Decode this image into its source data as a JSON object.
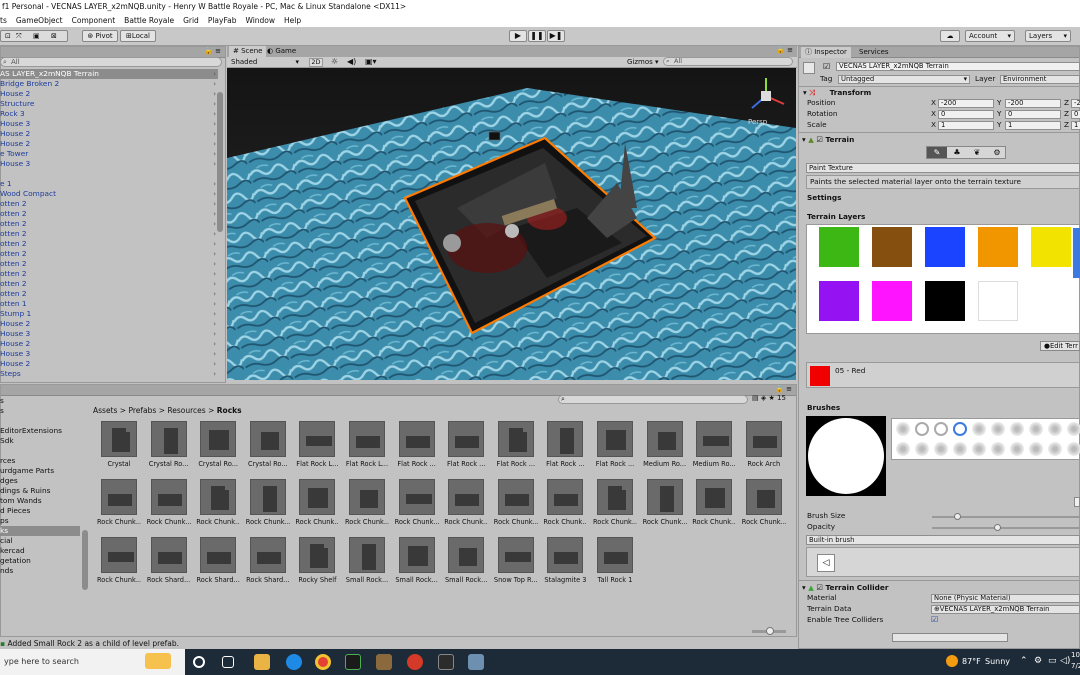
{
  "window": {
    "title": "f1 Personal - VECNAS LAYER_x2mNQB.unity - Henry W Battle Royale - PC, Mac & Linux Standalone <DX11>"
  },
  "menu": [
    "ts",
    "GameObject",
    "Component",
    "Battle Royale",
    "Grid",
    "PlayFab",
    "Window",
    "Help"
  ],
  "toolbar": {
    "pivot": "Pivot",
    "local": "Local",
    "account": "Account",
    "layers": "Layers"
  },
  "hierarchy": {
    "search_placeholder": "All",
    "items": [
      "AS LAYER_x2mNQB Terrain",
      "Bridge Broken 2",
      "House 2",
      "Structure",
      "Rock 3",
      "House 3",
      "House 2",
      "House 2",
      "e Tower",
      "House 3",
      "",
      "e 1",
      "Wood Compact",
      "otten 2",
      "otten 2",
      "otten 2",
      "otten 2",
      "otten 2",
      "otten 2",
      "otten 2",
      "otten 2",
      "otten 2",
      "otten 2",
      "otten 1",
      "Stump 1",
      "House 2",
      "House 3",
      "House 2",
      "House 3",
      "House 2",
      "Steps"
    ]
  },
  "scene": {
    "tab": "Scene",
    "game_tab": "Game",
    "shading": "Shaded",
    "mode2d": "2D",
    "gizmos": "Gizmos",
    "search_placeholder": "All",
    "persp": "Persp"
  },
  "project": {
    "folders": [
      "s",
      "s",
      "",
      "EditorExtensions",
      "Sdk",
      "",
      "rces",
      "urdgame Parts",
      "dges",
      "dings & Ruins",
      "tom Wands",
      "d Pieces",
      "ps",
      "ks",
      "cial",
      "kercad",
      "getation",
      "nds"
    ],
    "selected_folder_index": 13,
    "breadcrumb": [
      "Assets",
      "Prefabs",
      "Resources",
      "Rocks"
    ],
    "assets": [
      "Crystal",
      "Crystal Ro...",
      "Crystal Ro...",
      "Crystal Ro...",
      "Flat Rock L...",
      "Flat Rock L...",
      "Flat Rock ...",
      "Flat Rock ...",
      "Flat Rock ...",
      "Flat Rock ...",
      "Flat Rock ...",
      "Medium Ro...",
      "Medium Ro...",
      "Rock Arch",
      "Rock Chunk...",
      "Rock Chunk...",
      "Rock Chunk...",
      "Rock Chunk...",
      "Rock Chunk...",
      "Rock Chunk...",
      "Rock Chunk...",
      "Rock Chunk...",
      "Rock Chunk...",
      "Rock Chunk...",
      "Rock Chunk...",
      "Rock Chunk...",
      "Rock Chunk...",
      "Rock Chunk...",
      "Rock Chunk...",
      "Rock Shard...",
      "Rock Shard...",
      "Rock Shard...",
      "Rocky Shelf",
      "Small Rock...",
      "Small Rock...",
      "Small Rock...",
      "Snow Top R...",
      "Stalagmite 3",
      "Tall Rock 1"
    ],
    "badge": "15"
  },
  "status": {
    "message": "Added Small Rock 2 as a child of level prefab."
  },
  "inspector": {
    "tab": "Inspector",
    "services_tab": "Services",
    "object_name": "VECNAS LAYER_x2mNQB Terrain",
    "tag_label": "Tag",
    "tag_value": "Untagged",
    "layer_label": "Layer",
    "layer_value": "Environment",
    "transform": {
      "title": "Transform",
      "position_label": "Position",
      "rotation_label": "Rotation",
      "scale_label": "Scale",
      "x_label": "X",
      "y_label": "Y",
      "z_label": "Z",
      "position": {
        "x": "-200",
        "y": "-200",
        "z": "-2"
      },
      "rotation": {
        "x": "0",
        "y": "0",
        "z": "0"
      },
      "scale": {
        "x": "1",
        "y": "1",
        "z": "1"
      }
    },
    "terrain": {
      "title": "Terrain",
      "tool": "Paint Texture",
      "description": "Paints the selected material layer onto the terrain texture",
      "settings": "Settings",
      "layers_title": "Terrain Layers",
      "layer_colors": [
        "#3db714",
        "#85500f",
        "#1a44ff",
        "#f29600",
        "#f2e400",
        "#9512f2",
        "#ff14ff",
        "#000000",
        "#ffffff"
      ],
      "edit_button": "Edit Terr",
      "selected_layer": "05 - Red",
      "brushes_title": "Brushes",
      "brush_size_label": "Brush Size",
      "brush_size": 0.15,
      "opacity_label": "Opacity",
      "opacity": 0.42,
      "brush_source": "Built-in brush"
    },
    "collider": {
      "title": "Terrain Collider",
      "material_label": "Material",
      "material_value": "None (Physic Material)",
      "data_label": "Terrain Data",
      "data_value": "VECNAS LAYER_x2mNQB Terrain",
      "trees_label": "Enable Tree Colliders"
    }
  },
  "taskbar": {
    "search": "ype here to search",
    "temp": "87°F",
    "weather": "Sunny",
    "clock_top": "10:",
    "clock_bottom": "7/2"
  },
  "colors": {
    "water": "#3f8fae",
    "terrain_outline": "#ff7b00",
    "selection": "#8c8c8c",
    "link_text": "#1d3c9c"
  }
}
